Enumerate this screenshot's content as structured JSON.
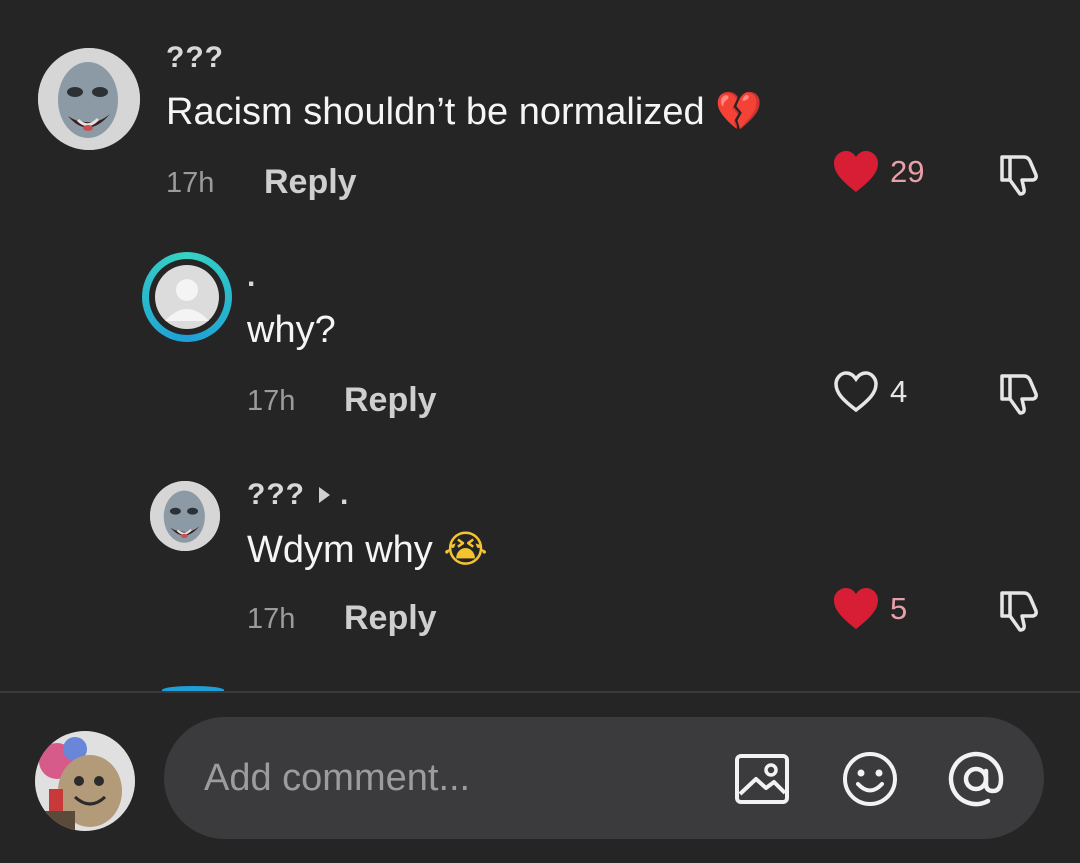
{
  "comments": [
    {
      "username": "???",
      "text": "Racism shouldn’t be normalized",
      "emoji": "💔",
      "time": "17h",
      "reply_label": "Reply",
      "likes": "29",
      "liked": true
    },
    {
      "username": ".",
      "text": "why?",
      "time": "17h",
      "reply_label": "Reply",
      "likes": "4",
      "liked": false
    },
    {
      "username": "???",
      "reply_to": ".",
      "text": "Wdym why",
      "emoji": "😭",
      "time": "17h",
      "reply_label": "Reply",
      "likes": "5",
      "liked": true
    }
  ],
  "composer": {
    "placeholder": "Add comment..."
  },
  "colors": {
    "background": "#252526",
    "like_active": "#d81e35",
    "like_count_active": "#e8a0a8",
    "input_bg": "#3b3b3d",
    "story_ring": "#1e9fd8"
  },
  "icons": {
    "like": "heart-icon",
    "dislike": "thumbs-down-icon",
    "image": "image-icon",
    "emoji": "smiley-icon",
    "mention": "at-sign-icon"
  }
}
